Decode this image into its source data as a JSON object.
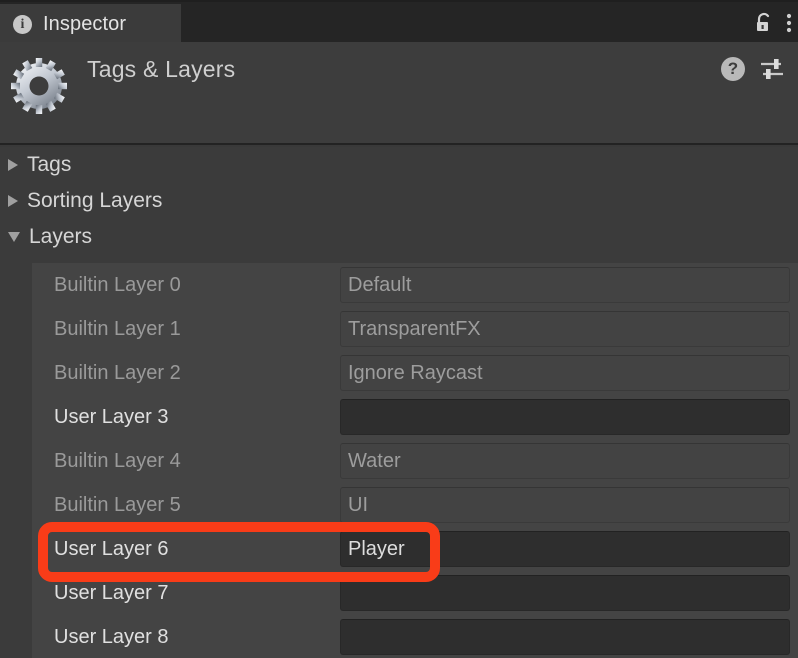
{
  "window": {
    "tab": {
      "label": "Inspector",
      "icon": "info-icon"
    },
    "lock_icon": "unlock-icon",
    "menu_icon": "kebab-menu-icon"
  },
  "header": {
    "title": "Tags & Layers",
    "object_icon": "gear-settings-icon",
    "help_icon": "help-icon",
    "preset_icon": "preset-sliders-icon"
  },
  "sections": [
    {
      "label": "Tags",
      "expanded": false,
      "icon": "chevron-right-icon"
    },
    {
      "label": "Sorting Layers",
      "expanded": false,
      "icon": "chevron-right-icon"
    },
    {
      "label": "Layers",
      "expanded": true,
      "icon": "chevron-down-icon"
    }
  ],
  "layers": [
    {
      "name": "Builtin Layer 0",
      "value": "Default",
      "builtin": true,
      "placeholder": ""
    },
    {
      "name": "Builtin Layer 1",
      "value": "TransparentFX",
      "builtin": true,
      "placeholder": ""
    },
    {
      "name": "Builtin Layer 2",
      "value": "Ignore Raycast",
      "builtin": true,
      "placeholder": ""
    },
    {
      "name": "User Layer 3",
      "value": "",
      "builtin": false,
      "placeholder": ""
    },
    {
      "name": "Builtin Layer 4",
      "value": "Water",
      "builtin": true,
      "placeholder": ""
    },
    {
      "name": "Builtin Layer 5",
      "value": "UI",
      "builtin": true,
      "placeholder": ""
    },
    {
      "name": "User Layer 6",
      "value": "Player",
      "builtin": false,
      "placeholder": ""
    },
    {
      "name": "User Layer 7",
      "value": "",
      "builtin": false,
      "placeholder": ""
    },
    {
      "name": "User Layer 8",
      "value": "",
      "builtin": false,
      "placeholder": ""
    }
  ],
  "annotation": {
    "target_row": "User Layer 6",
    "color": "#f93c18",
    "shape": "rounded-rectangle"
  },
  "colors": {
    "tabbar_bg": "#252525",
    "tab_active_bg": "#3b3b3b",
    "header_bg": "#3d3d3d",
    "body_bg": "#3b3b3b",
    "list_bg": "#444444",
    "field_readonly_bg": "#434343",
    "field_editable_bg": "#2e2e2e",
    "text_primary": "#e0e0e0",
    "text_disabled": "#9a9a9a"
  }
}
